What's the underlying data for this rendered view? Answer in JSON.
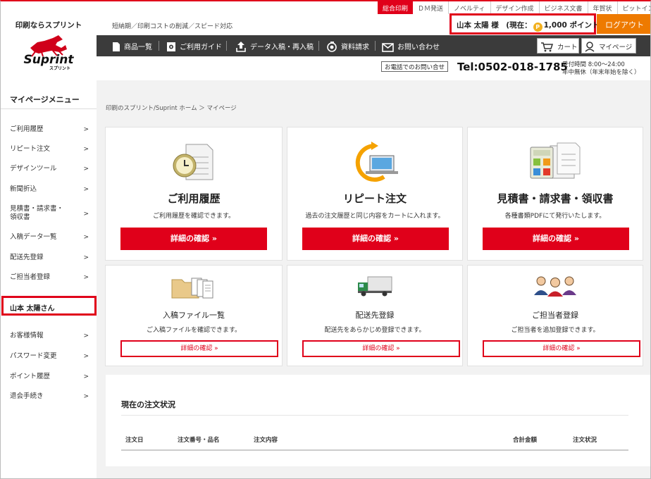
{
  "sidebar": {
    "tagline": "印刷ならスプリント",
    "logo_text": "Suprint",
    "logo_sub": "スプリント",
    "menu_title": "マイページメニュー",
    "items": [
      {
        "label": "ご利用履歴"
      },
      {
        "label": "リピート注文"
      },
      {
        "label": "デザインツール"
      },
      {
        "label": "新聞折込"
      },
      {
        "label": "見積書・請求書・領収書",
        "line1": "見積書・請求書・",
        "line2": "領収書"
      },
      {
        "label": "入稿データ一覧"
      },
      {
        "label": "配送先登録"
      },
      {
        "label": "ご担当者登録"
      }
    ],
    "user_name": "山本 太陽さん",
    "account_items": [
      {
        "label": "お客様情報"
      },
      {
        "label": "パスワード変更"
      },
      {
        "label": "ポイント履歴"
      },
      {
        "label": "退会手続き"
      }
    ],
    "arrow": ">"
  },
  "top_tabs": [
    "総合印刷",
    "ＤＭ発送",
    "ノベルティ",
    "デザイン作成",
    "ビジネス文書",
    "年賀状",
    "ピットイン"
  ],
  "header": {
    "subtag": "短納期／印刷コストの削減／スピード対応",
    "user_prefix": "山本 太陽 様　(現在：",
    "coin": "P",
    "points": "1,000 ポイント)",
    "logout": "ログアウト"
  },
  "nav": {
    "items": [
      "商品一覧",
      "ご利用ガイド",
      "データ入稿・再入稿",
      "資料請求",
      "お問い合わせ"
    ],
    "cart": "カート",
    "mypage": "マイページ"
  },
  "contact": {
    "phone_button": "お電話でのお問い合せ",
    "phone": "Tel:0502-018-1785",
    "hours1": "受付時間 8:00〜24:00",
    "hours2": "年中無休（年末年始を除く）"
  },
  "breadcrumb": "印刷のスプリント/Suprint ホーム ＞ マイページ",
  "cards_main": [
    {
      "title": "ご利用履歴",
      "desc": "ご利用履歴を確認できます。",
      "button": "詳細の確認 »"
    },
    {
      "title": "リピート注文",
      "desc": "過去の注文履歴と同じ内容をカートに入れます。",
      "button": "詳細の確認 »"
    },
    {
      "title": "見積書・請求書・領収書",
      "desc": "各種書類PDFにて発行いたします。",
      "button": "詳細の確認 »"
    }
  ],
  "cards_sub": [
    {
      "title": "入稿ファイル一覧",
      "desc": "ご入稿ファイルを確認できます。",
      "button": "詳細の確認 »"
    },
    {
      "title": "配送先登録",
      "desc": "配送先をあらかじめ登録できます。",
      "button": "詳細の確認 »"
    },
    {
      "title": "ご担当者登録",
      "desc": "ご担当者を追加登録できます。",
      "button": "詳細の確認 »"
    }
  ],
  "order_status": {
    "title": "現在の注文状況",
    "columns": [
      "注文日",
      "注文番号・品名",
      "注文内容",
      "合計金額",
      "注文状況"
    ]
  },
  "colors": {
    "accent": "#e0001a",
    "logout": "#ee7a00",
    "nav": "#3b3b3b"
  }
}
